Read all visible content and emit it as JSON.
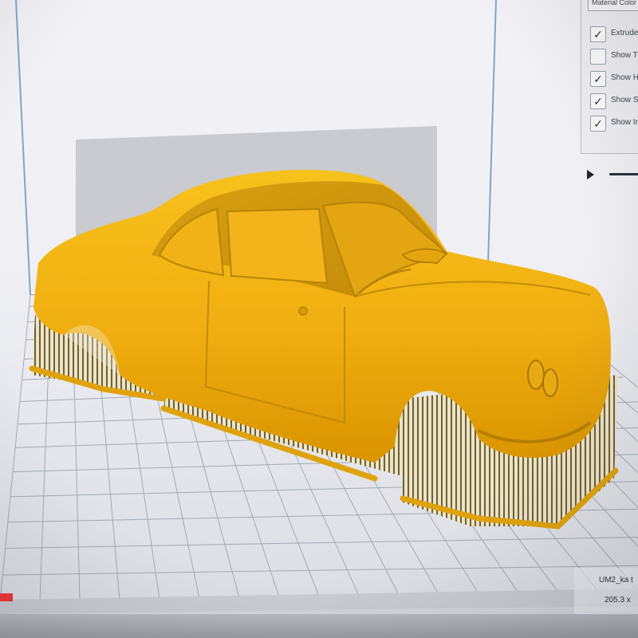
{
  "sidebar": {
    "material_dropdown": "Material Color",
    "options": [
      {
        "label": "Extruder",
        "checked": true
      },
      {
        "label": "Show Travels",
        "checked": false
      },
      {
        "label": "Show Helpers",
        "checked": true
      },
      {
        "label": "Show Shell",
        "checked": true
      },
      {
        "label": "Show Infill",
        "checked": true
      }
    ]
  },
  "layer_slider": {
    "play_icon": "play-icon"
  },
  "model_info": {
    "file_name": "UM2_ka t",
    "dimensions": "205.3 x"
  },
  "colors": {
    "model": "#f2b318",
    "support": "#7a6a3c",
    "build_plate": "#e2e4ea",
    "grid_line": "#9aa0aa",
    "back_wall": "#c9cbd1"
  }
}
